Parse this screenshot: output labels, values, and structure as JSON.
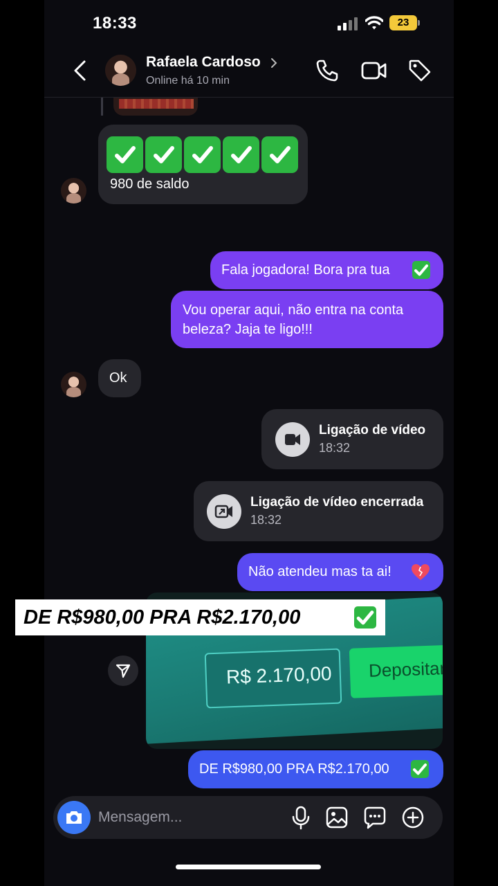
{
  "status_bar": {
    "time": "18:33",
    "battery": "23"
  },
  "header": {
    "contact_name": "Rafaela Cardoso",
    "contact_status": "Online há 10 min"
  },
  "messages": {
    "m1_text": "980 de saldo",
    "m2_text": "Fala jogadora! Bora pra tua",
    "m3_line1": "Vou operar aqui, não entra na conta",
    "m3_line2": "beleza? Jaja te ligo!!!",
    "m4_text": "Ok",
    "call1_title": "Ligação de vídeo",
    "call1_time": "18:32",
    "call2_title": "Ligação de vídeo encerrada",
    "call2_time": "18:32",
    "m5_text": "Não atendeu mas ta ai!",
    "photo_amount": "R$ 2.170,00",
    "photo_button": "Depositar",
    "overlay_caption": "DE R$980,00 PRA R$2.170,00",
    "m6_text": "DE R$980,00 PRA R$2.170,00"
  },
  "composer": {
    "placeholder": "Mensagem..."
  },
  "colors": {
    "outgoing_purple": "#7a3ff2",
    "outgoing_blue": "#3d58f0",
    "incoming": "#26262c",
    "check_green": "#2db742",
    "camera_blue": "#3a78f5"
  },
  "icons": [
    "back-icon",
    "phone-icon",
    "video-icon",
    "tag-icon",
    "video-call-icon",
    "video-call-ended-icon",
    "share-icon",
    "camera-icon",
    "mic-icon",
    "gallery-icon",
    "sticker-icon",
    "plus-icon",
    "check-icon",
    "heart-icon"
  ]
}
